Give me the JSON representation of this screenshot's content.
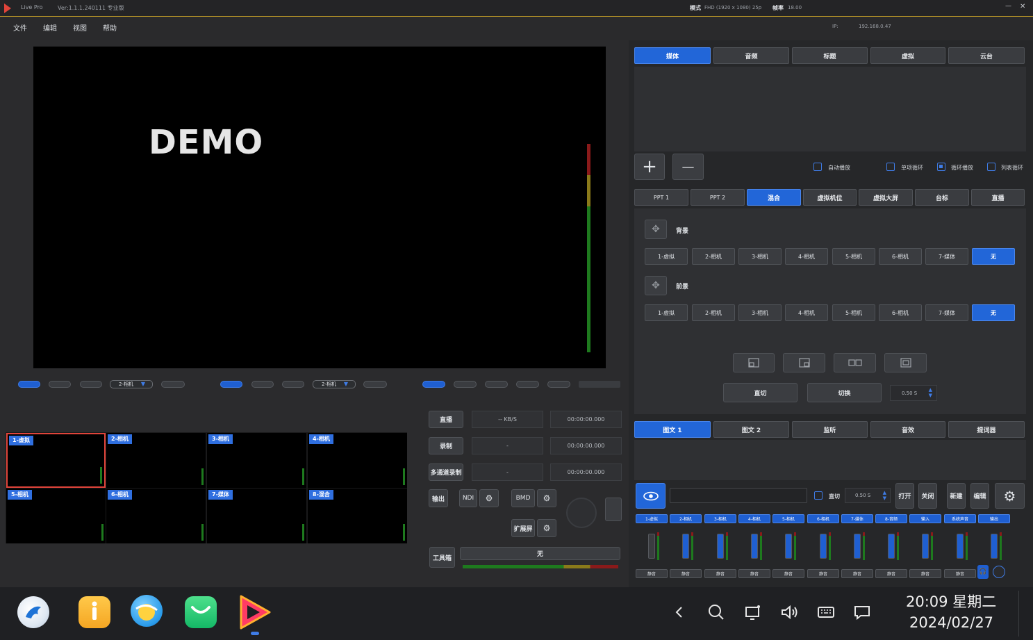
{
  "titlebar": {
    "app_name": "Live Pro",
    "version": "Ver:1.1.1.240111 专业版",
    "mode_label": "模式",
    "mode_value": "FHD (1920 x 1080)  25p",
    "rate_label": "帧率",
    "rate_value": "18.00",
    "minimize": "—",
    "close": "✕"
  },
  "menu": {
    "items": [
      "文件",
      "编辑",
      "视图",
      "帮助"
    ],
    "ip_label": "IP:",
    "ip_value": "192.168.0.47"
  },
  "preview": {
    "watermark": "DEMO"
  },
  "monitor_controls": {
    "group1_select": "2-相机",
    "group2_select": "2-相机"
  },
  "multiview": {
    "cells": [
      "1-虚拟",
      "2-相机",
      "3-相机",
      "4-相机",
      "5-相机",
      "6-相机",
      "7-媒体",
      "8-混合"
    ]
  },
  "stream": {
    "live_label": "直播",
    "live_rate": "-- KB/S",
    "live_time": "00:00:00.000",
    "record_label": "录制",
    "record_value": "-",
    "record_time": "00:00:00.000",
    "multirecord_label": "多通道录制",
    "multirecord_value": "-",
    "multirecord_time": "00:00:00.000",
    "output_label": "输出",
    "ndi_label": "NDI",
    "bmd_label": "BMD",
    "extend_label": "扩展屏",
    "toolbox_label": "工具箱",
    "transition_label": "无"
  },
  "top_tabs": {
    "tabs": [
      "媒体",
      "音频",
      "标题",
      "虚拟",
      "云台"
    ],
    "active": 0
  },
  "playlist_options": {
    "add": "+",
    "remove": "—",
    "auto_play": "自动播放",
    "single_loop": "单项循环",
    "loop_play": "循环播放",
    "list_loop": "列表循环"
  },
  "source_tabs": {
    "tabs": [
      "PPT 1",
      "PPT 2",
      "混合",
      "虚拟机位",
      "虚拟大屏",
      "台标",
      "直播"
    ],
    "active": 2
  },
  "mix": {
    "background_label": "背景",
    "foreground_label": "前景",
    "background_sources": [
      "1-虚拟",
      "2-相机",
      "3-相机",
      "4-相机",
      "5-相机",
      "6-相机",
      "7-媒体",
      "无"
    ],
    "foreground_sources": [
      "1-虚拟",
      "2-相机",
      "3-相机",
      "4-相机",
      "5-相机",
      "6-相机",
      "7-媒体",
      "无"
    ],
    "direct_label": "直切",
    "switch_label": "切换",
    "duration": "0.50 S"
  },
  "bottom_tabs": {
    "tabs": [
      "图文 1",
      "图文 2",
      "监听",
      "音效",
      "提词器"
    ],
    "active": 0
  },
  "overlay_controls": {
    "direct_label": "直切",
    "duration": "0.50 S",
    "open_label": "打开",
    "close_label": "关闭",
    "new_label": "新建",
    "edit_label": "编辑"
  },
  "audio": {
    "channels": [
      "1-虚拟",
      "2-相机",
      "3-相机",
      "4-相机",
      "5-相机",
      "6-相机",
      "7-媒体",
      "8-音频",
      "输入",
      "系统声音",
      "输出"
    ],
    "footers": [
      "静音",
      "静音",
      "静音",
      "静音",
      "静音",
      "静音",
      "静音",
      "静音",
      "静音",
      "静音"
    ]
  },
  "taskbar": {
    "time": "20:09 星期二",
    "date": "2024/02/27"
  },
  "colors": {
    "accent": "#2266d8",
    "title_border": "#c9a227",
    "selected_cell": "#e0443a"
  }
}
